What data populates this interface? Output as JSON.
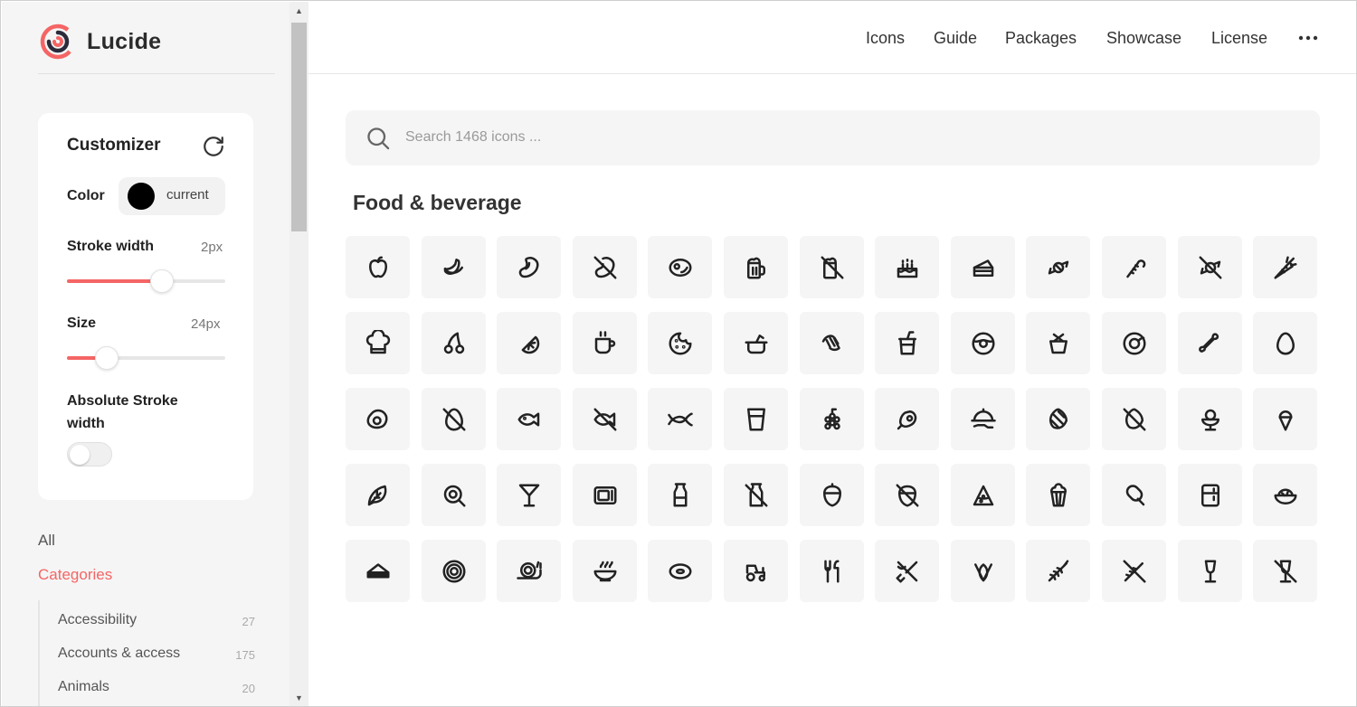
{
  "brand": {
    "name": "Lucide",
    "logo_color": "#f56565"
  },
  "header": {
    "nav": [
      "Icons",
      "Guide",
      "Packages",
      "Showcase",
      "License"
    ],
    "more_icon": "more-horizontal-icon"
  },
  "customizer": {
    "title": "Customizer",
    "reset_icon": "rotate-cw-icon",
    "color_label": "Color",
    "color_value": "current",
    "color_swatch": "#000000",
    "stroke_label": "Stroke width",
    "stroke_value": "2px",
    "stroke_fraction": 0.6,
    "size_label": "Size",
    "size_value": "24px",
    "size_fraction": 0.25,
    "absolute_label": "Absolute Stroke width",
    "absolute_enabled": false
  },
  "sidebar": {
    "all_label": "All",
    "categories_label": "Categories",
    "categories": [
      {
        "name": "Accessibility",
        "count": "27"
      },
      {
        "name": "Accounts & access",
        "count": "175"
      },
      {
        "name": "Animals",
        "count": "20"
      }
    ]
  },
  "search": {
    "placeholder": "Search 1468 icons ...",
    "icon": "search-icon"
  },
  "section": {
    "title": "Food & beverage"
  },
  "accent_color": "#f56565",
  "icons": [
    "apple",
    "banana",
    "bean",
    "bean-off",
    "beef",
    "beer",
    "beer-off",
    "cake",
    "cake-slice",
    "candy",
    "candy-cane",
    "candy-off",
    "carrot",
    "chef-hat",
    "cherry",
    "citrus",
    "coffee",
    "cookie",
    "cooking-pot",
    "croissant",
    "cup-soda",
    "donut",
    "dessert",
    "drumstick",
    "dumbbell-bone",
    "egg",
    "egg-fried",
    "egg-off",
    "fish",
    "fish-off",
    "fish-symbol",
    "glass-water",
    "grape",
    "ham",
    "hand-platter",
    "hop",
    "hop-off",
    "ice-cream-bowl",
    "ice-cream-cone",
    "leafy-green",
    "lollipop",
    "martini",
    "microwave",
    "milk",
    "milk-off",
    "nut",
    "nut-off",
    "pizza",
    "popcorn",
    "popsicle",
    "refrigerator",
    "salad",
    "sandwich",
    "shell",
    "snail",
    "soup",
    "torus",
    "tractor",
    "utensils",
    "utensils-crossed",
    "vegan",
    "wheat",
    "wheat-off",
    "wine",
    "wine-off"
  ]
}
